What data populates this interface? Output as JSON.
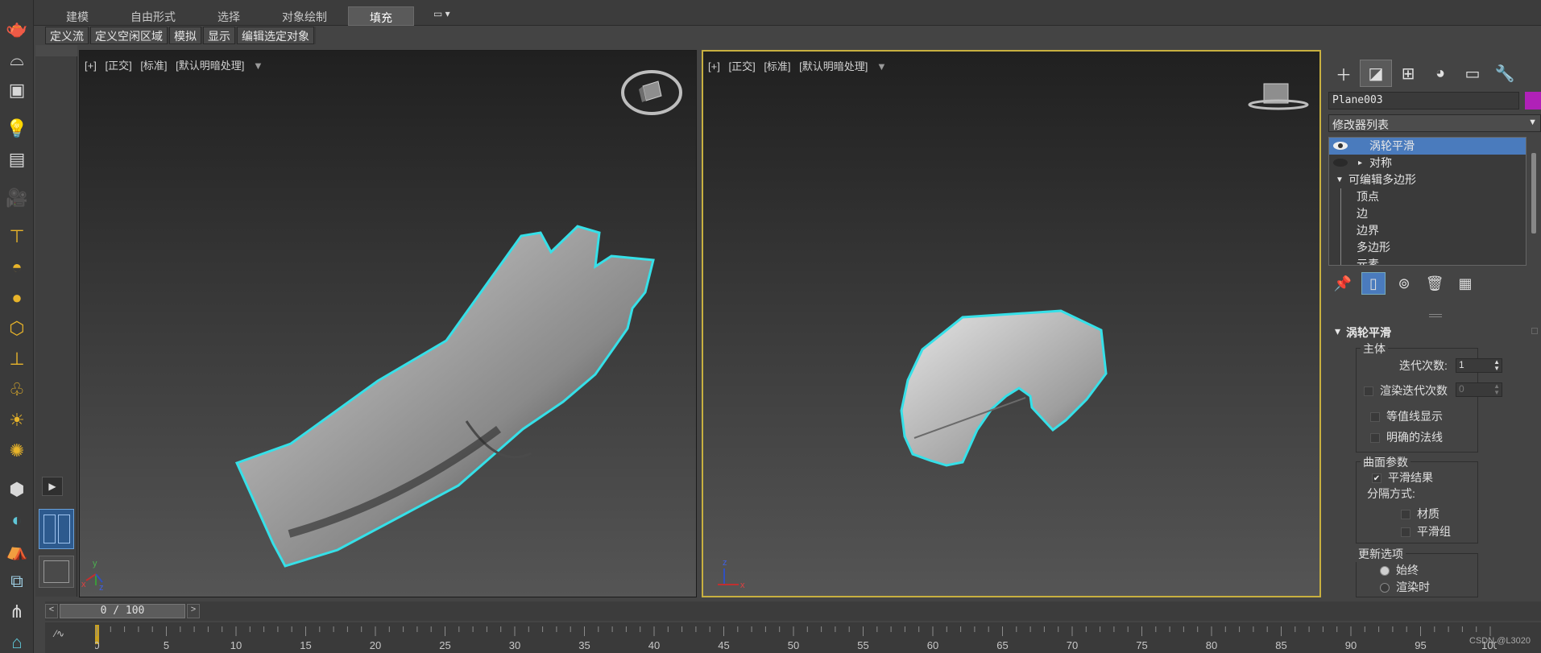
{
  "ribbon": {
    "tabs": [
      "建模",
      "自由形式",
      "选择",
      "对象绘制",
      "填充"
    ],
    "active_tab": "填充",
    "sub_buttons": [
      "定义流",
      "定义空闲区域",
      "模拟",
      "显示",
      "编辑选定对象"
    ]
  },
  "left_icons": [
    "teapot-icon",
    "dome-icon",
    "box-light-icon",
    "light-bulb-icon",
    "camera-light-icon",
    "video-camera-icon",
    "spotlight-icon",
    "half-dome-icon",
    "sphere-icon",
    "geodesic-icon",
    "omni-light-icon",
    "bulb-light-icon",
    "sun-icon",
    "sunburst-icon",
    "cube-icon",
    "sky-sphere-icon",
    "tent-icon",
    "dual-cube-icon",
    "grass-icon",
    "helper-icon"
  ],
  "viewports": {
    "left": {
      "labels": [
        "[+]",
        "[正交]",
        "[标准]",
        "[默认明暗处理]"
      ],
      "axes": {
        "y": "y",
        "x": "x",
        "z": "z"
      }
    },
    "right": {
      "labels": [
        "[+]",
        "[正交]",
        "[标准]",
        "[默认明暗处理]"
      ],
      "axes": {
        "z": "z",
        "x": "x"
      }
    }
  },
  "command_panel": {
    "tab_icons": [
      "create-plus-icon",
      "modify-icon",
      "hierarchy-icon",
      "motion-icon",
      "display-icon",
      "utilities-wrench-icon"
    ],
    "object_name": "Plane003",
    "object_color": "#b021b8",
    "modifier_list": "修改器列表",
    "stack": [
      {
        "label": "涡轮平滑",
        "selected": true
      },
      {
        "label": "对称",
        "selected": false
      },
      {
        "label": "可编辑多边形",
        "selected": false
      },
      {
        "label": "顶点",
        "selected": false
      },
      {
        "label": "边",
        "selected": false
      },
      {
        "label": "边界",
        "selected": false
      },
      {
        "label": "多边形",
        "selected": false
      },
      {
        "label": "元素",
        "selected": false
      }
    ],
    "rollout": {
      "title": "涡轮平滑",
      "main_group": "主体",
      "iterations_label": "迭代次数:",
      "iterations_value": "1",
      "render_iters_label": "渲染迭代次数",
      "render_iters_value": "0",
      "isoline_label": "等值线显示",
      "explicit_normals_label": "明确的法线",
      "surface_group": "曲面参数",
      "smooth_result_label": "平滑结果",
      "separate_by_label": "分隔方式:",
      "material_label": "材质",
      "smoothing_groups_label": "平滑组",
      "update_group": "更新选项",
      "always_label": "始终",
      "when_rendering_label": "渲染时"
    }
  },
  "timeline": {
    "slider_text": "0 / 100",
    "prev_label": "<",
    "next_label": ">",
    "ticks": [
      "0",
      "5",
      "10",
      "15",
      "20",
      "25",
      "30",
      "35",
      "40",
      "45",
      "50",
      "55",
      "60",
      "65",
      "70",
      "75",
      "80",
      "85",
      "90",
      "95",
      "100"
    ]
  },
  "watermark": "CSDN @L3020"
}
